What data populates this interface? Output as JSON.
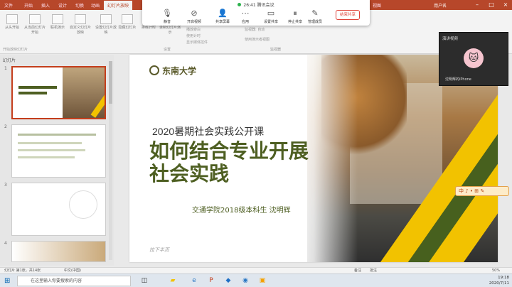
{
  "titlebar": {
    "tabs": [
      "文件",
      "开始",
      "插入",
      "设计",
      "切换",
      "动画",
      "幻灯片放映",
      "审阅",
      "视图",
      "帮助",
      "书签"
    ],
    "active_tab": "幻灯片放映",
    "user": "用户名"
  },
  "ribbon": {
    "buttons": [
      "从头开始",
      "从当前幻灯片开始",
      "联机演示",
      "自定义幻灯片放映",
      "设置幻灯片放映",
      "隐藏幻灯片",
      "排练计时",
      "录制幻灯片演示"
    ],
    "groups": [
      "开始放映幻灯片",
      "设置",
      "监视器"
    ],
    "checks": [
      "播放旁白",
      "使用计时",
      "显示媒体控件"
    ],
    "monitor": "监视器: 自动",
    "presenter": "使用演示者视图"
  },
  "meeting": {
    "time": "26:41",
    "app": "腾讯会议",
    "tools": [
      "静音",
      "开启视频",
      "共享屏幕",
      "管理成员",
      "应用",
      "设置共享",
      "停止共享",
      "结束共享"
    ],
    "end": "结束共享"
  },
  "thumbpane": {
    "header": "幻灯片",
    "numbers": [
      "1",
      "2",
      "3",
      "4"
    ]
  },
  "slide": {
    "logo": "东南大学",
    "subtitle": "2020暑期社会实践公开课",
    "title": "如何结合专业开展社会实践",
    "author": "交通学院2018级本科生 沈明辉",
    "signature": "拉下半页"
  },
  "video": {
    "header": "演讲视频",
    "name": "沈明辉的iPhone"
  },
  "floatbar": "中 ♪ • ⊞ ✎",
  "statusbar": {
    "slide": "幻灯片 第1张，共14张",
    "lang": "中文(中国)",
    "notes": "备注",
    "comments": "批注",
    "zoom": "50%"
  },
  "taskbar": {
    "search": "在这里输入你要搜索的内容",
    "time": "19:18",
    "date": "2020/7/11"
  },
  "colors": {
    "accent": "#b7472a",
    "title_green": "#4e5f22",
    "stripe_yellow": "#f2c200",
    "stripe_green": "#47601e"
  }
}
